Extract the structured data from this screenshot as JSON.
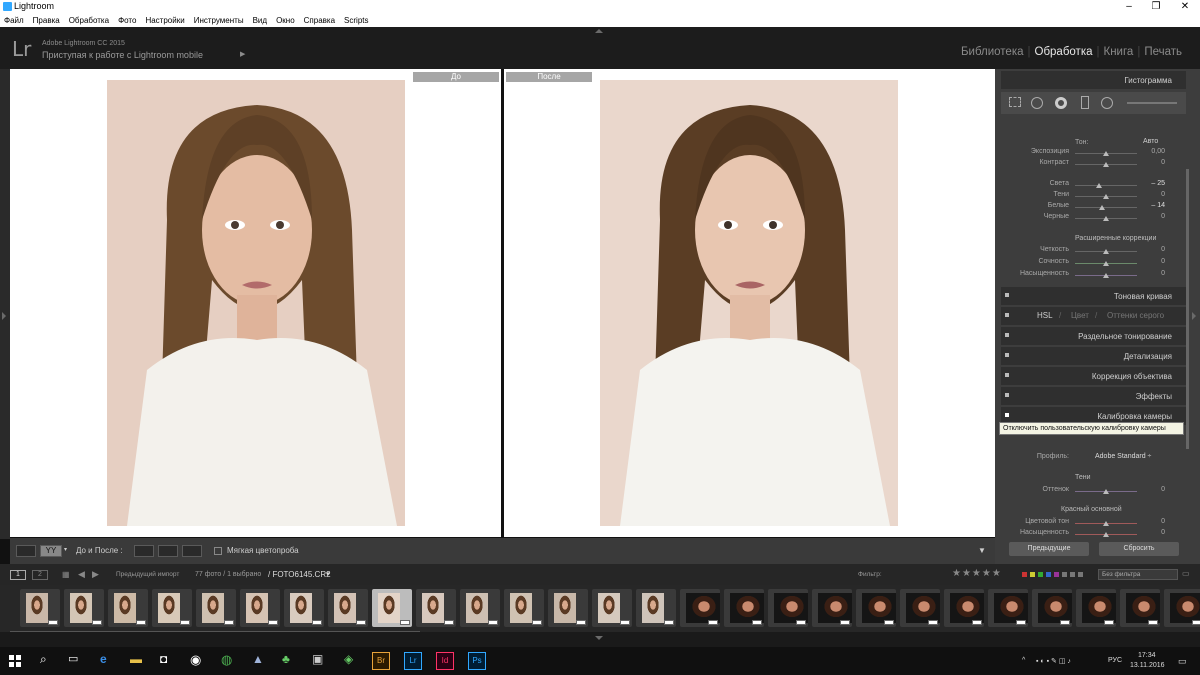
{
  "window": {
    "title": "Lightroom",
    "controls": [
      "–",
      "❐",
      "✕"
    ]
  },
  "menu": [
    "Файл",
    "Правка",
    "Обработка",
    "Фото",
    "Настройки",
    "Инструменты",
    "Вид",
    "Окно",
    "Справка",
    "Scripts"
  ],
  "identity": {
    "logo": "Lr",
    "product": "Adobe Lightroom CC 2015",
    "subtitle": "Приступая к работе с Lightroom mobile"
  },
  "modules": [
    "Библиотека",
    "Обработка",
    "Книга",
    "Печать"
  ],
  "active_module": "Обработка",
  "compare": {
    "before_label": "До",
    "after_label": "После"
  },
  "toolbar": {
    "view_label": "YY",
    "before_after": "До и После :",
    "soft_proof": "Мягкая цветопроба"
  },
  "right_panel": {
    "histogram_title": "Гистограмма",
    "tone": {
      "label": "Тон:",
      "auto": "Авто",
      "rows": [
        {
          "label": "Экспозиция",
          "value": "0,00"
        },
        {
          "label": "Контраст",
          "value": "0"
        },
        {
          "label": "Света",
          "value": "– 25"
        },
        {
          "label": "Тени",
          "value": "0"
        },
        {
          "label": "Белые",
          "value": "– 14"
        },
        {
          "label": "Черные",
          "value": "0"
        }
      ]
    },
    "presence": {
      "title": "Расширенные коррекции",
      "rows": [
        {
          "label": "Четкость",
          "value": "0"
        },
        {
          "label": "Сочность",
          "value": "0"
        },
        {
          "label": "Насыщенность",
          "value": "0"
        }
      ]
    },
    "sections": [
      "Тоновая кривая",
      "Раздельное тонирование",
      "Детализация",
      "Коррекция объектива",
      "Эффекты",
      "Калибровка камеры"
    ],
    "hsl": {
      "hsl": "HSL",
      "color": "Цвет",
      "gray": "Оттенки серого"
    },
    "tooltip": "Отключить пользовательскую калибровку камеры",
    "calibration": {
      "profile_label": "Профиль:",
      "profile_value": "Adobe Standard ÷",
      "shadows": "Тени",
      "tint": "Оттенок",
      "tint_value": "0",
      "red_primary": "Красный основной",
      "hue": "Цветовой тон",
      "hue_value": "0",
      "saturation": "Насыщенность",
      "saturation_value": "0"
    },
    "buttons": {
      "previous": "Предыдущие",
      "reset": "Сбросить"
    }
  },
  "filmstrip": {
    "page1": "1",
    "page2": "2",
    "source": "Предыдущий импорт",
    "count": "77 фото / 1 выбрано",
    "filename": "/ FOTO6145.CR2",
    "filter_label": "Фильтр:",
    "filter_value": "Без фильтра"
  },
  "taskbar": {
    "lang": "РУС",
    "time": "17:34",
    "date": "13.11.2016",
    "apps": [
      "Br",
      "Lr",
      "Id",
      "Ps"
    ]
  },
  "colors": {
    "brand_lr": "#31a8ff",
    "bg_dark": "#1c1c1c",
    "panel": "#3d3d3d"
  }
}
